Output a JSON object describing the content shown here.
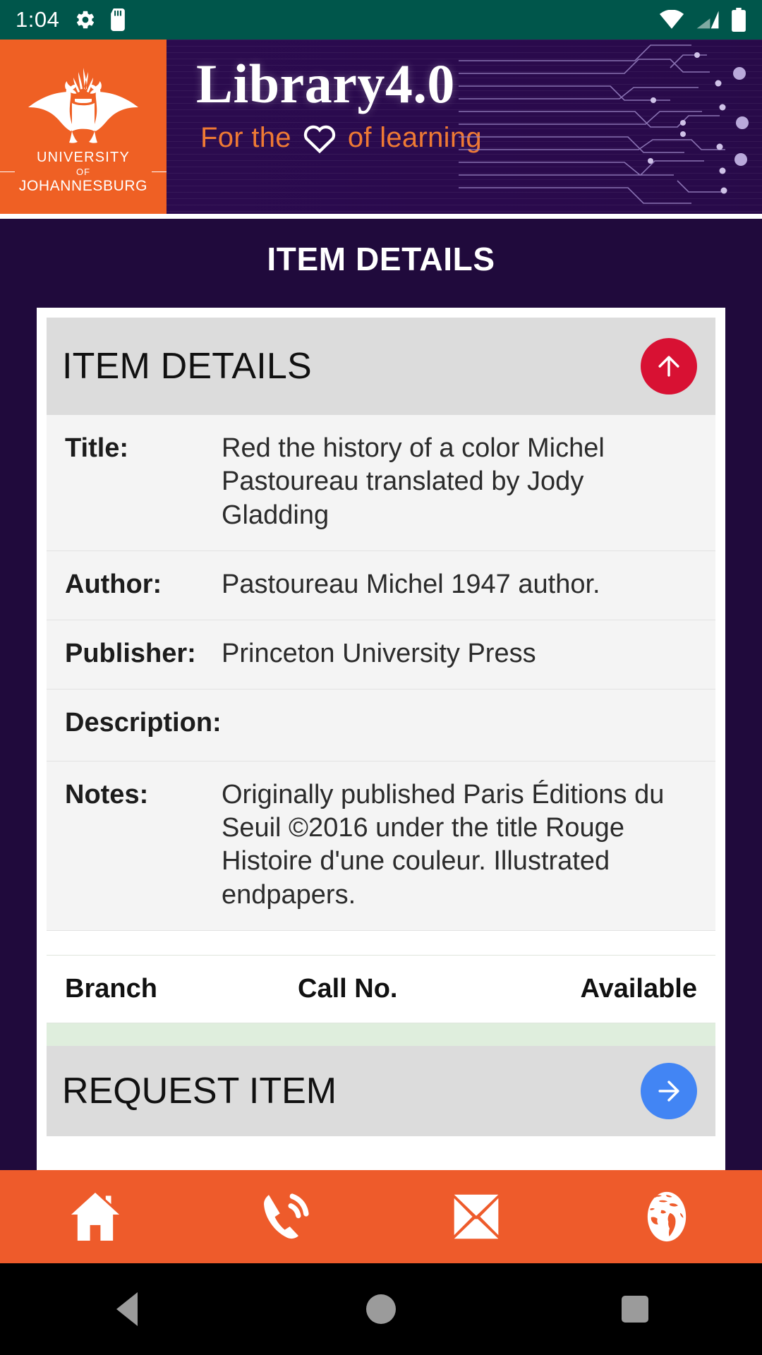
{
  "status_bar": {
    "time": "1:04",
    "left_icons": [
      "gear-icon",
      "sd-card-icon"
    ],
    "right_icons": [
      "wifi-icon",
      "cellular-signal-icon",
      "battery-icon"
    ],
    "background_color": "#00564b"
  },
  "banner": {
    "logo": {
      "line1": "UNIVERSITY",
      "line2": "OF",
      "line3": "JOHANNESBURG",
      "background_color": "#ef6024"
    },
    "brand_title": "Library4.0",
    "tagline_before": "For the",
    "tagline_after": "of learning",
    "tagline_icon": "heart-icon",
    "background_color": "#2b0b4e",
    "accent_color": "#ef7a34"
  },
  "page": {
    "heading": "ITEM DETAILS"
  },
  "card": {
    "header_title": "ITEM DETAILS",
    "scroll_top_button": {
      "icon": "arrow-up-icon",
      "color": "#d81133"
    },
    "fields": [
      {
        "label": "Title:",
        "value": "Red the history of a color Michel Pastoureau translated by Jody Gladding"
      },
      {
        "label": "Author:",
        "value": "Pastoureau Michel 1947 author."
      },
      {
        "label": "Publisher:",
        "value": "Princeton University Press"
      },
      {
        "label": "Description:",
        "value": ""
      },
      {
        "label": "Notes:",
        "value": "Originally published Paris Éditions du Seuil ©2016 under the title Rouge Histoire d'une couleur. Illustrated endpapers."
      }
    ],
    "holdings_table": {
      "columns": [
        "Branch",
        "Call No.",
        "Available"
      ],
      "rows": []
    },
    "request_section": {
      "title": "REQUEST ITEM",
      "button": {
        "icon": "arrow-right-icon",
        "color": "#4285f4"
      }
    }
  },
  "bottom_nav": {
    "background_color": "#ee5b2b",
    "items": [
      {
        "name": "home",
        "icon": "home-icon"
      },
      {
        "name": "call",
        "icon": "phone-icon"
      },
      {
        "name": "email",
        "icon": "envelope-icon"
      },
      {
        "name": "web",
        "icon": "globe-icon"
      }
    ]
  },
  "android_nav": {
    "items": [
      {
        "name": "back",
        "icon": "back-triangle-icon"
      },
      {
        "name": "home",
        "icon": "home-circle-icon"
      },
      {
        "name": "recents",
        "icon": "recents-square-icon"
      }
    ]
  }
}
